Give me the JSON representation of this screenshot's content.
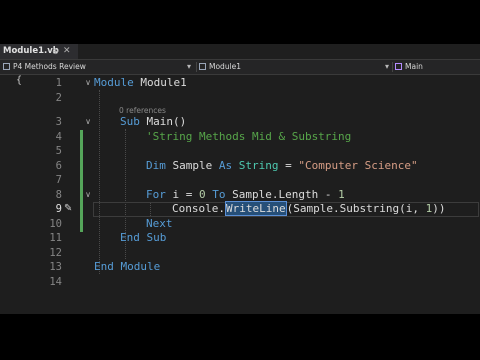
{
  "tab": {
    "name": "Module1.vb",
    "pin": "⊕",
    "close": "✕"
  },
  "nav": {
    "project": "P4 Methods Review",
    "module": "Module1",
    "member": "Main",
    "dropdown_glyph": "▾"
  },
  "editor": {
    "gutter_glyph": "{",
    "current_line": 9,
    "code_lens": "0 references",
    "line_numbers": [
      "1",
      "2",
      "3",
      "4",
      "5",
      "6",
      "7",
      "8",
      "9",
      "10",
      "11",
      "12",
      "13",
      "14"
    ],
    "fold_markers": [
      "∨",
      "∨",
      "∨"
    ],
    "lines": {
      "l1": {
        "kw": "Module",
        "rest": " Module1"
      },
      "l3": {
        "kw": "Sub",
        "rest": " Main()"
      },
      "l4": {
        "comment": "'String Methods Mid & Substring"
      },
      "l6": {
        "kw1": "Dim",
        "name": " Sample ",
        "kw2": "As",
        "sp": " ",
        "type": "String",
        "op": " = ",
        "str": "\"Computer Science\""
      },
      "l8": {
        "kw1": "For",
        "a": " i = ",
        "n0": "0",
        "sp": " ",
        "kw2": "To",
        "b": " Sample.Length - ",
        "n1": "1"
      },
      "l9": {
        "a": "Console.",
        "hl": "WriteLine",
        "b": "(Sample.Substring(i, ",
        "n1": "1",
        "c": "))"
      },
      "l10": {
        "kw": "Next"
      },
      "l11": {
        "kw": "End Sub"
      },
      "l13": {
        "kw": "End Module"
      }
    }
  },
  "colors": {
    "keyword": "#569cd6",
    "type": "#4ec9b0",
    "comment": "#57a64a",
    "string": "#d69d85",
    "number": "#b5cea8",
    "change_bar": "#55a55a"
  }
}
